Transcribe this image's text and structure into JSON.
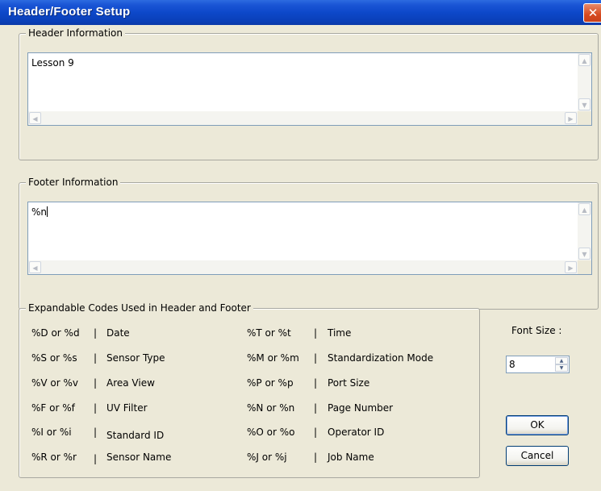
{
  "window": {
    "title": "Header/Footer Setup",
    "close_symbol": "✕"
  },
  "header": {
    "group_label": "Header Information",
    "text": "Lesson 9"
  },
  "footer": {
    "group_label": "Footer Information",
    "text": "%n"
  },
  "codes": {
    "group_label": "Expandable Codes Used in Header and Footer",
    "separator": "|",
    "left": [
      {
        "code": "%D or %d",
        "label": "Date"
      },
      {
        "code": "%S or %s",
        "label": "Sensor Type"
      },
      {
        "code": "%V or %v",
        "label": "Area View"
      },
      {
        "code": "%F or %f",
        "label": "UV Filter"
      },
      {
        "code": "%I or %i",
        "label": "Standard ID"
      },
      {
        "code": "%R or %r",
        "label": "Sensor Name"
      }
    ],
    "right": [
      {
        "code": "%T or %t",
        "label": "Time"
      },
      {
        "code": "%M or %m",
        "label": "Standardization Mode"
      },
      {
        "code": "%P or %p",
        "label": "Port Size"
      },
      {
        "code": "%N or %n",
        "label": "Page Number"
      },
      {
        "code": "%O or %o",
        "label": "Operator ID"
      },
      {
        "code": "%J or %j",
        "label": "Job Name"
      }
    ]
  },
  "font_size": {
    "label": "Font Size :",
    "value": "8"
  },
  "buttons": {
    "ok": "OK",
    "cancel": "Cancel"
  },
  "icons": {
    "scroll_up": "▲",
    "scroll_down": "▼",
    "scroll_left": "◀",
    "scroll_right": "▶",
    "spin_up": "▲",
    "spin_down": "▼"
  }
}
